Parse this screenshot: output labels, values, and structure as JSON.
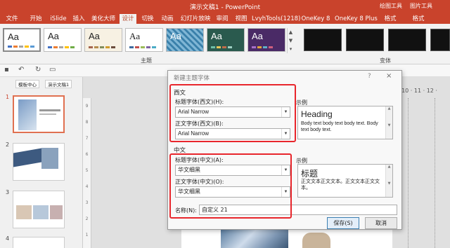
{
  "window": {
    "title": "演示文稿1 - PowerPoint"
  },
  "contextual_tools": [
    "绘图工具",
    "图片工具"
  ],
  "ribbon_tabs": [
    "文件",
    "开始",
    "iSlide",
    "插入",
    "美化大师",
    "设计",
    "切换",
    "动画",
    "幻灯片放映",
    "审阅",
    "视图",
    "LvyhTools(1218)",
    "OneKey 8",
    "OneKey 8 Plus",
    "格式",
    "格式"
  ],
  "active_tab": "设计",
  "ribbon": {
    "themes_group_label": "主题",
    "variants_group_label": "变体",
    "theme_sample": "Aa"
  },
  "doc_tabs": [
    "模板中心",
    "演示文稿1"
  ],
  "slides": [
    "1",
    "2",
    "3",
    "4"
  ],
  "ruler": {
    "h_marks": "· 10 · 11 · 12 ·"
  },
  "dialog": {
    "title": "新建主题字体",
    "help": "?",
    "close": "×",
    "western": {
      "section_label": "西文",
      "heading_label": "标题字体(西文)(H):",
      "heading_value": "Arial Narrow",
      "body_label": "正文字体(西文)(B):",
      "body_value": "Arial Narrow",
      "preview_label": "示例",
      "preview_heading": "Heading",
      "preview_body": "Body text body text body text. Body text body text."
    },
    "asian": {
      "section_label": "中文",
      "heading_label": "标题字体(中文)(A):",
      "heading_value": "华文细黑",
      "body_label": "正文字体(中文)(O):",
      "body_value": "华文细黑",
      "preview_label": "示例",
      "preview_heading": "标题",
      "preview_body": "正文文本正文文本。正文文本正文文本。"
    },
    "name_label": "名称(N):",
    "name_value": "自定义 21",
    "save_label": "保存(S)",
    "cancel_label": "取消"
  },
  "colors": {
    "titlebar": "#c9432c",
    "highlight": "#e8262c",
    "active_tab_text": "#b7472a"
  }
}
